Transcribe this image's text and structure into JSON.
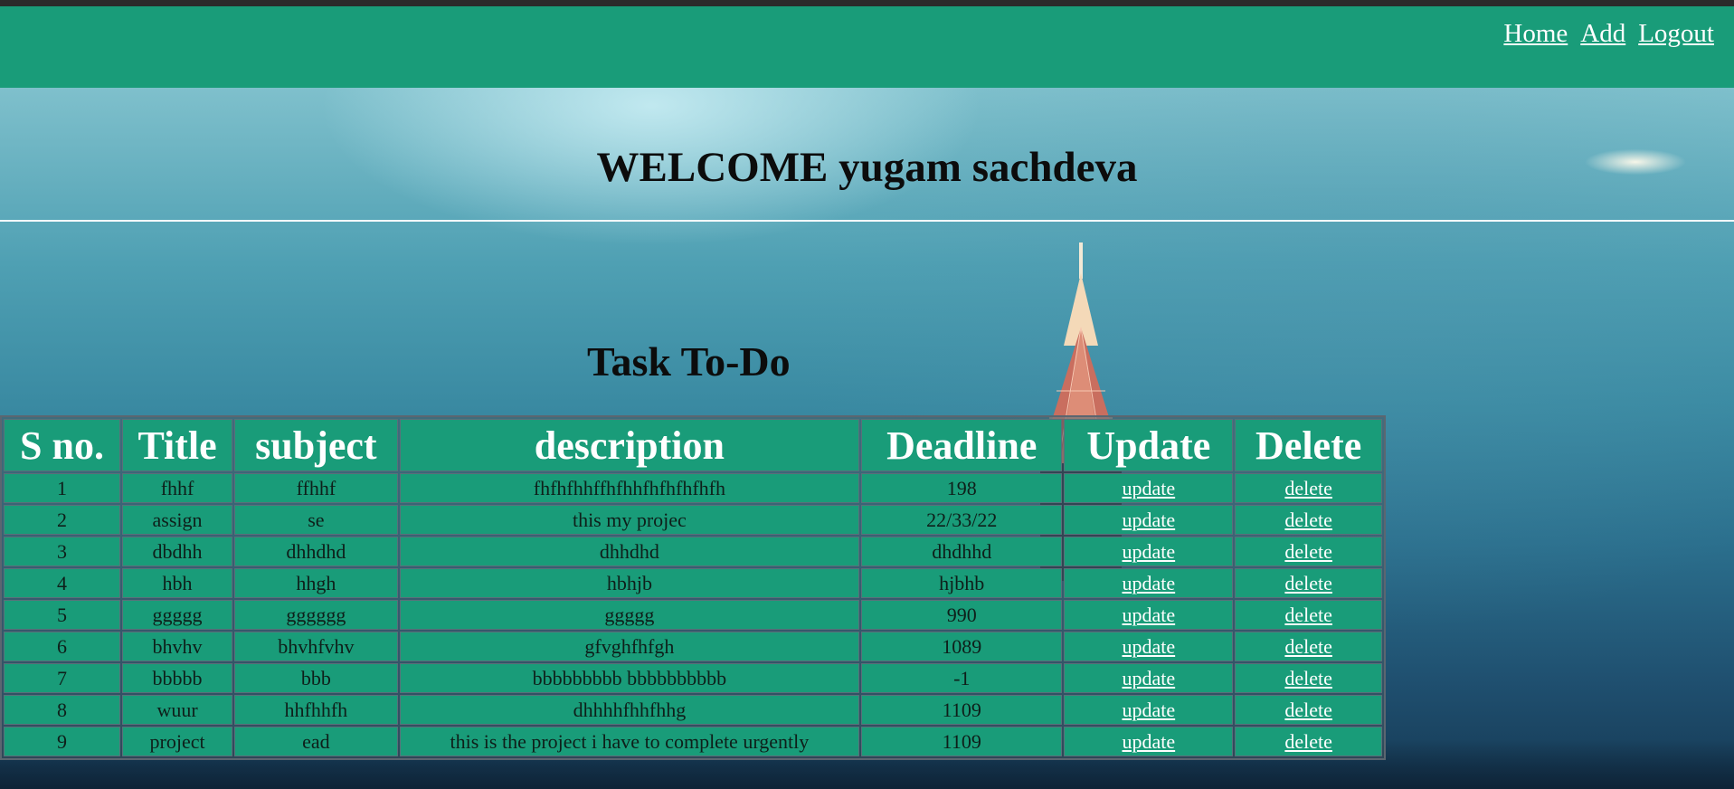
{
  "nav": {
    "links": [
      "Home",
      "Add",
      "Logout"
    ]
  },
  "welcome_text": "WELCOME yugam sachdeva",
  "task_heading": "Task To-Do",
  "table": {
    "headers": [
      "S no.",
      "Title",
      "subject",
      "description",
      "Deadline",
      "Update",
      "Delete"
    ],
    "rows": [
      {
        "sno": "1",
        "title": "fhhf",
        "subject": "ffhhf",
        "description": "fhfhfhhffhfhhfhfhfhfhfh",
        "deadline": "198",
        "update": "update",
        "delete": "delete"
      },
      {
        "sno": "2",
        "title": "assign",
        "subject": "se",
        "description": "this my projec",
        "deadline": "22/33/22",
        "update": "update",
        "delete": "delete"
      },
      {
        "sno": "3",
        "title": "dbdhh",
        "subject": "dhhdhd",
        "description": "dhhdhd",
        "deadline": "dhdhhd",
        "update": "update",
        "delete": "delete"
      },
      {
        "sno": "4",
        "title": "hbh",
        "subject": "hhgh",
        "description": "hbhjb",
        "deadline": "hjbhb",
        "update": "update",
        "delete": "delete"
      },
      {
        "sno": "5",
        "title": "ggggg",
        "subject": "gggggg",
        "description": "ggggg",
        "deadline": "990",
        "update": "update",
        "delete": "delete"
      },
      {
        "sno": "6",
        "title": "bhvhv",
        "subject": "bhvhfvhv",
        "description": "gfvghfhfgh",
        "deadline": "1089",
        "update": "update",
        "delete": "delete"
      },
      {
        "sno": "7",
        "title": "bbbbb",
        "subject": "bbb",
        "description": "bbbbbbbbb bbbbbbbbbb",
        "deadline": "-1",
        "update": "update",
        "delete": "delete"
      },
      {
        "sno": "8",
        "title": "wuur",
        "subject": "hhfhhfh",
        "description": "dhhhhfhhfhhg",
        "deadline": "1109",
        "update": "update",
        "delete": "delete"
      },
      {
        "sno": "9",
        "title": "project",
        "subject": "ead",
        "description": "this is the project i have to complete urgently",
        "deadline": "1109",
        "update": "update",
        "delete": "delete"
      }
    ]
  },
  "colors": {
    "navbar": "#199c79",
    "table_cell": "#199c79",
    "link_text": "#ffffff"
  }
}
